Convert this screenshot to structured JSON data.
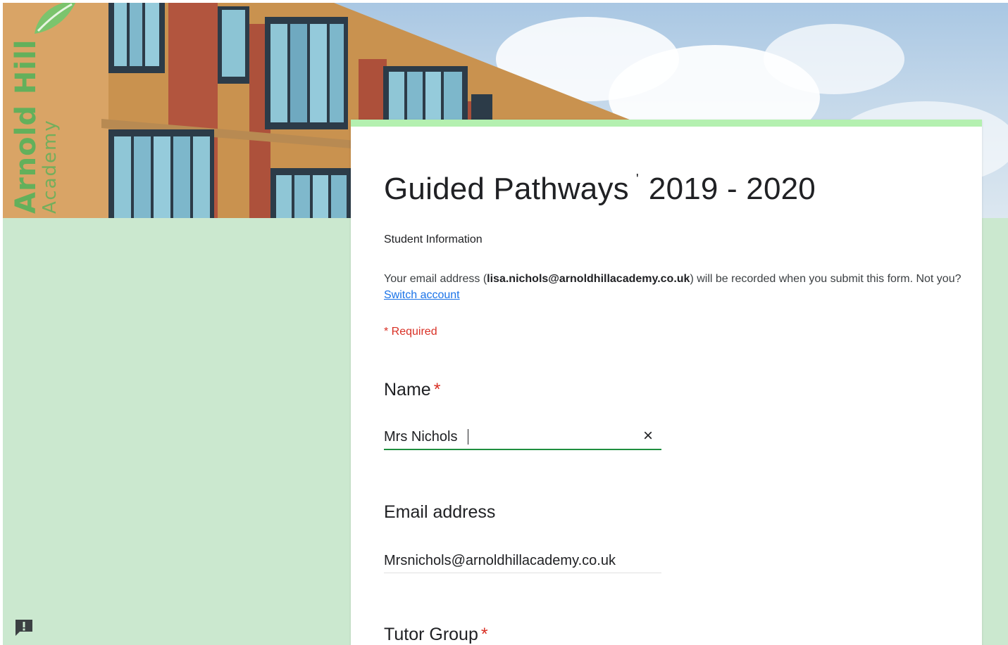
{
  "header": {
    "logo_line1": "Arnold Hill",
    "logo_line2": "Academy"
  },
  "form": {
    "title_part1": "Guided Pathways",
    "title_part2": "2019 - 2020",
    "description": "Student Information",
    "email_notice_prefix": "Your email address (",
    "email_notice_email": "lisa.nichols@arnoldhillacademy.co.uk",
    "email_notice_suffix": ") will be recorded when you submit this form. Not you? ",
    "switch_account_label": "Switch account",
    "required_note": "* Required"
  },
  "questions": {
    "name": {
      "label": "Name",
      "required_mark": "*",
      "value": "Mrs Nichols",
      "clear_icon": "×"
    },
    "email": {
      "label": "Email address",
      "value": "Mrsnichols@arnoldhillacademy.co.uk"
    },
    "tutor_group": {
      "label": "Tutor Group",
      "required_mark": "*"
    }
  },
  "icons": {
    "clear": "close-icon",
    "feedback": "feedback-icon"
  },
  "colors": {
    "page_background": "#cbe8cf",
    "card_accent": "#b4f0b0",
    "required": "#d93025",
    "focus_underline": "#1e8e3e",
    "link": "#1a73e8"
  }
}
